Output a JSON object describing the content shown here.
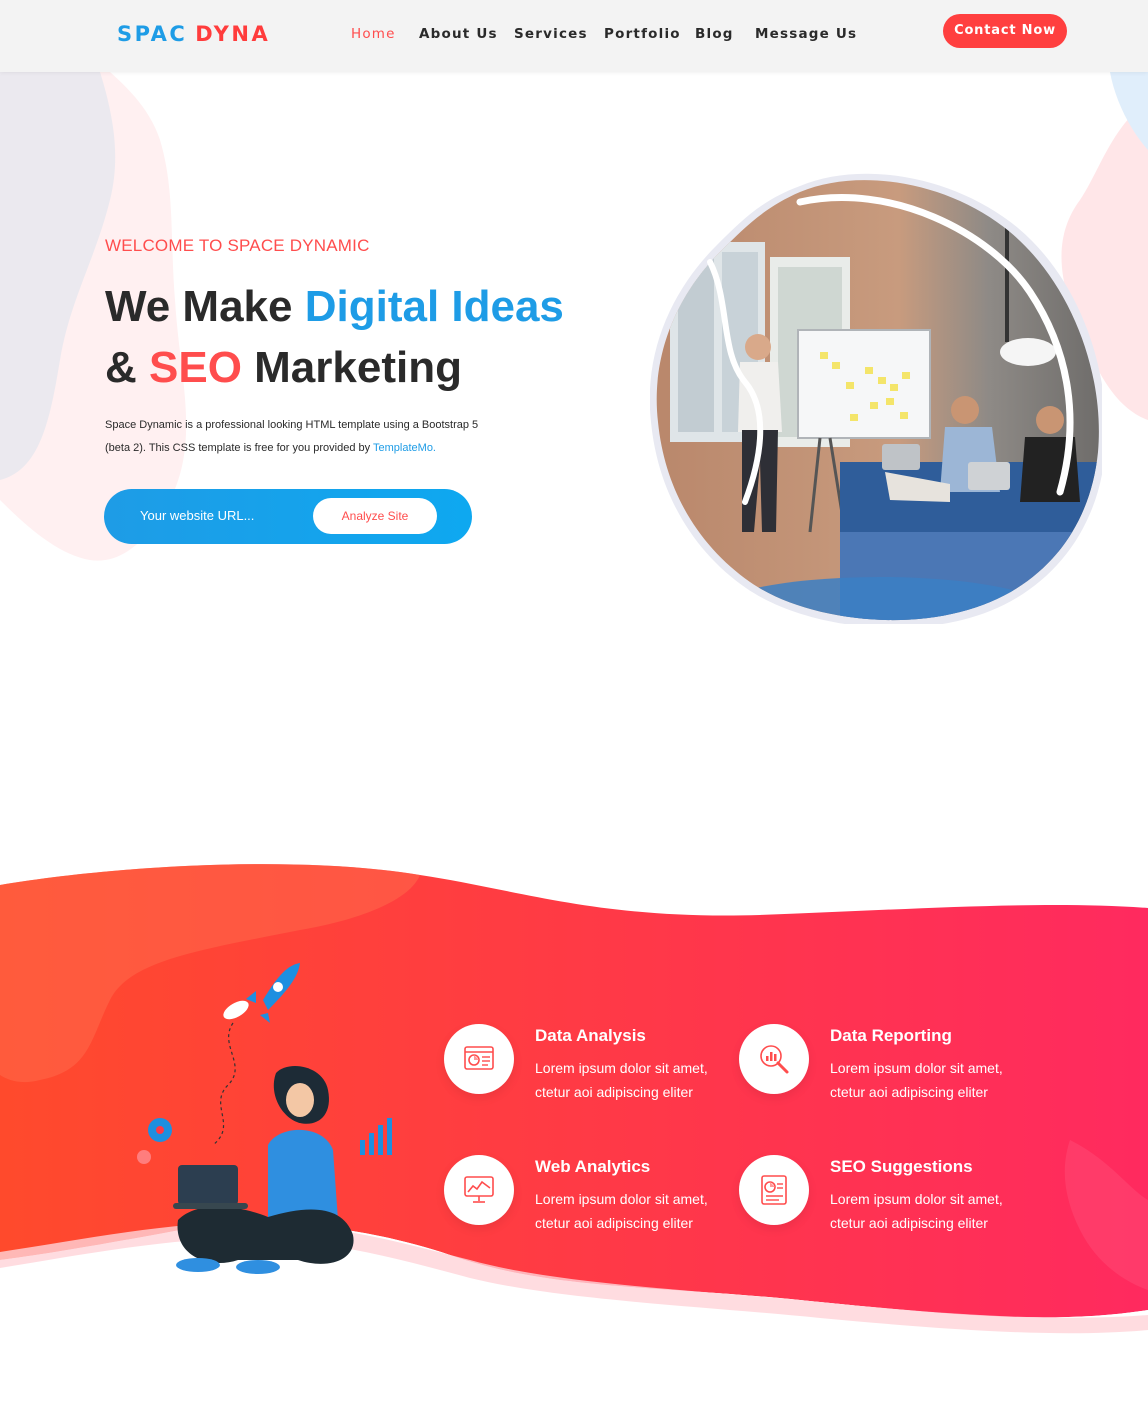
{
  "colors": {
    "accent_red": "#ff4d4d",
    "accent_blue": "#1e9ce6",
    "header_bg": "#f3f3f3"
  },
  "header": {
    "logo_part1": "SPAC",
    "logo_part2": "DYNA",
    "nav": [
      {
        "label": "Home",
        "active": true
      },
      {
        "label": "About Us",
        "active": false
      },
      {
        "label": "Services",
        "active": false
      },
      {
        "label": "Portfolio",
        "active": false
      },
      {
        "label": "Blog",
        "active": false
      },
      {
        "label": "Message Us",
        "active": false
      }
    ],
    "contact_button": "Contact Now"
  },
  "hero": {
    "eyebrow": "WELCOME TO SPACE DYNAMIC",
    "title_line1_a": "We Make ",
    "title_line1_b": "Digital Ideas",
    "title_line2_a": "& ",
    "title_line2_b": "SEO",
    "title_line2_c": " Marketing",
    "description": "Space Dynamic is a professional looking HTML template using a Bootstrap 5 (beta 2). This CSS template is free for you provided by ",
    "description_link": "TemplateMo.",
    "search_placeholder": "Your website URL...",
    "analyze_button": "Analyze Site",
    "image_icon": "office-team-meeting-photo"
  },
  "services": {
    "illustration_icon": "woman-laptop-rocket-illustration",
    "items": [
      {
        "title": "Data Analysis",
        "text": "Lorem ipsum dolor sit amet, ctetur aoi adipiscing eliter",
        "icon": "report-chart-icon"
      },
      {
        "title": "Data Reporting",
        "text": "Lorem ipsum dolor sit amet, ctetur aoi adipiscing eliter",
        "icon": "magnifier-chart-icon"
      },
      {
        "title": "Web Analytics",
        "text": "Lorem ipsum dolor sit amet, ctetur aoi adipiscing eliter",
        "icon": "monitor-analytics-icon"
      },
      {
        "title": "SEO Suggestions",
        "text": "Lorem ipsum dolor sit amet, ctetur aoi adipiscing eliter",
        "icon": "document-chart-icon"
      }
    ]
  }
}
